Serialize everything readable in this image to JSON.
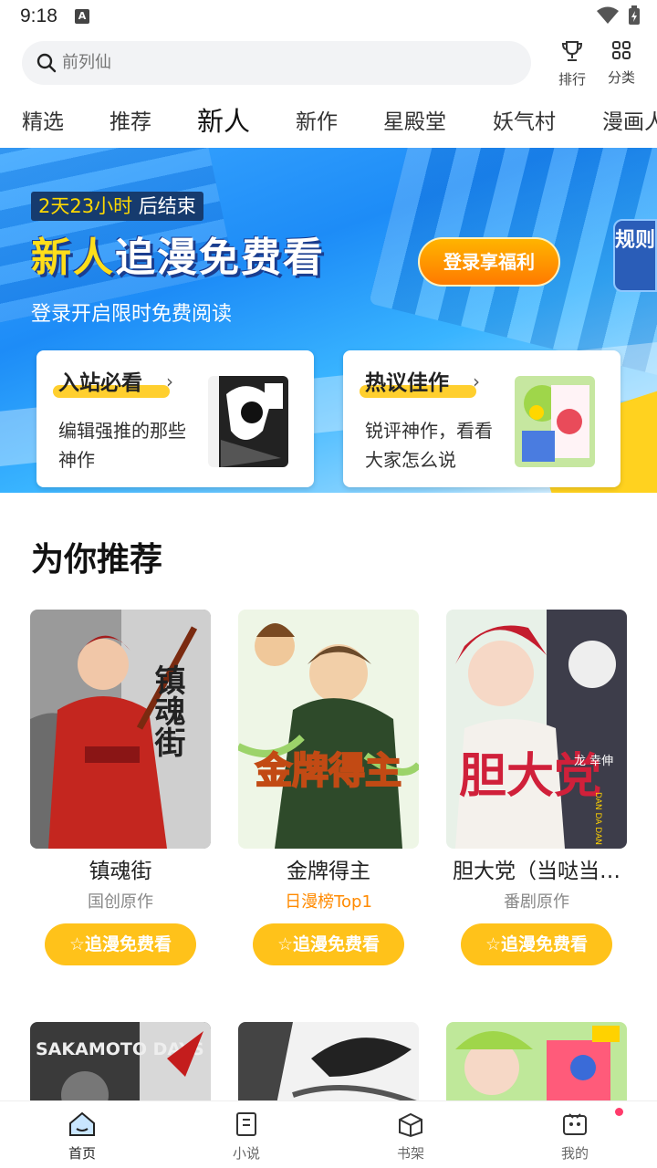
{
  "status": {
    "time": "9:18"
  },
  "search": {
    "placeholder": "前列仙"
  },
  "top_actions": {
    "rank": "排行",
    "category": "分类"
  },
  "tabs": [
    "精选",
    "推荐",
    "新人",
    "新作",
    "星殿堂",
    "妖气村",
    "漫画人"
  ],
  "active_tab": "新人",
  "banner": {
    "timer_value": "2天23小时",
    "timer_suffix": " 后结束",
    "title_a": "新人",
    "title_b": "追漫免费看",
    "subtitle": "登录开启限时免费阅读",
    "login_button": "登录享福利",
    "rules": "规则"
  },
  "cards": [
    {
      "title": "入站必看",
      "desc": "编辑强推的那些神作"
    },
    {
      "title": "热议佳作",
      "desc": "锐评神作，看看大家怎么说"
    }
  ],
  "section": {
    "title": "为你推荐"
  },
  "books": [
    {
      "name": "镇魂街",
      "tag": "国创原作",
      "button": "☆追漫免费看"
    },
    {
      "name": "金牌得主",
      "tag": "日漫榜Top1",
      "button": "☆追漫免费看"
    },
    {
      "name": "胆大党（当哒当…",
      "tag": "番剧原作",
      "button": "☆追漫免费看"
    }
  ],
  "cover_text": {
    "book1": "镇魂街",
    "book2": "金牌得主",
    "book3": "胆大党",
    "book3_author": "龙 幸伸",
    "book3_romaji": "DAN DA DAN",
    "book4": "SAKAMOTO DAYS"
  },
  "bottom_nav": [
    "首页",
    "小说",
    "书架",
    "我的"
  ],
  "colors": {
    "accent": "#ffc21a",
    "tag_orange": "#ff8a00",
    "banner_blue": "#1d8cf7"
  }
}
